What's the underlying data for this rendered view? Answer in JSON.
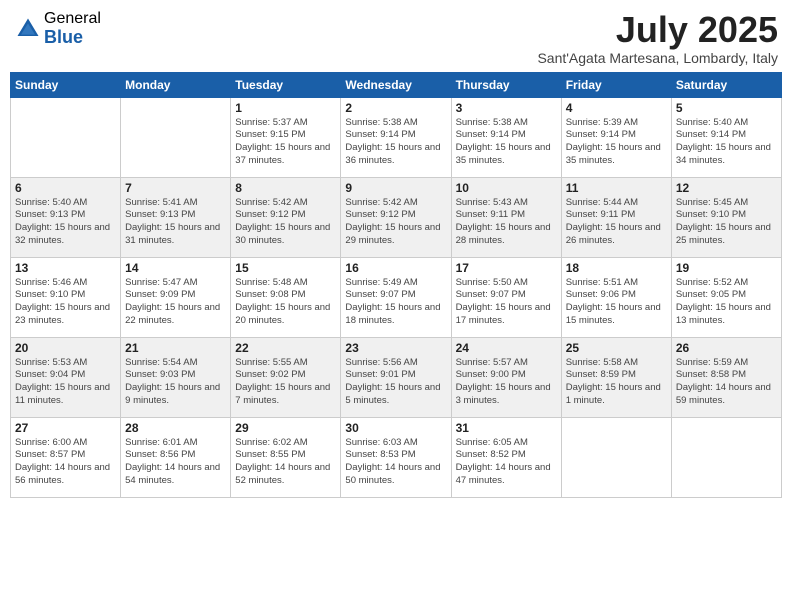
{
  "header": {
    "logo_general": "General",
    "logo_blue": "Blue",
    "month_title": "July 2025",
    "subtitle": "Sant'Agata Martesana, Lombardy, Italy"
  },
  "weekdays": [
    "Sunday",
    "Monday",
    "Tuesday",
    "Wednesday",
    "Thursday",
    "Friday",
    "Saturday"
  ],
  "weeks": [
    [
      {
        "day": "",
        "sunrise": "",
        "sunset": "",
        "daylight": ""
      },
      {
        "day": "",
        "sunrise": "",
        "sunset": "",
        "daylight": ""
      },
      {
        "day": "1",
        "sunrise": "Sunrise: 5:37 AM",
        "sunset": "Sunset: 9:15 PM",
        "daylight": "Daylight: 15 hours and 37 minutes."
      },
      {
        "day": "2",
        "sunrise": "Sunrise: 5:38 AM",
        "sunset": "Sunset: 9:14 PM",
        "daylight": "Daylight: 15 hours and 36 minutes."
      },
      {
        "day": "3",
        "sunrise": "Sunrise: 5:38 AM",
        "sunset": "Sunset: 9:14 PM",
        "daylight": "Daylight: 15 hours and 35 minutes."
      },
      {
        "day": "4",
        "sunrise": "Sunrise: 5:39 AM",
        "sunset": "Sunset: 9:14 PM",
        "daylight": "Daylight: 15 hours and 35 minutes."
      },
      {
        "day": "5",
        "sunrise": "Sunrise: 5:40 AM",
        "sunset": "Sunset: 9:14 PM",
        "daylight": "Daylight: 15 hours and 34 minutes."
      }
    ],
    [
      {
        "day": "6",
        "sunrise": "Sunrise: 5:40 AM",
        "sunset": "Sunset: 9:13 PM",
        "daylight": "Daylight: 15 hours and 32 minutes."
      },
      {
        "day": "7",
        "sunrise": "Sunrise: 5:41 AM",
        "sunset": "Sunset: 9:13 PM",
        "daylight": "Daylight: 15 hours and 31 minutes."
      },
      {
        "day": "8",
        "sunrise": "Sunrise: 5:42 AM",
        "sunset": "Sunset: 9:12 PM",
        "daylight": "Daylight: 15 hours and 30 minutes."
      },
      {
        "day": "9",
        "sunrise": "Sunrise: 5:42 AM",
        "sunset": "Sunset: 9:12 PM",
        "daylight": "Daylight: 15 hours and 29 minutes."
      },
      {
        "day": "10",
        "sunrise": "Sunrise: 5:43 AM",
        "sunset": "Sunset: 9:11 PM",
        "daylight": "Daylight: 15 hours and 28 minutes."
      },
      {
        "day": "11",
        "sunrise": "Sunrise: 5:44 AM",
        "sunset": "Sunset: 9:11 PM",
        "daylight": "Daylight: 15 hours and 26 minutes."
      },
      {
        "day": "12",
        "sunrise": "Sunrise: 5:45 AM",
        "sunset": "Sunset: 9:10 PM",
        "daylight": "Daylight: 15 hours and 25 minutes."
      }
    ],
    [
      {
        "day": "13",
        "sunrise": "Sunrise: 5:46 AM",
        "sunset": "Sunset: 9:10 PM",
        "daylight": "Daylight: 15 hours and 23 minutes."
      },
      {
        "day": "14",
        "sunrise": "Sunrise: 5:47 AM",
        "sunset": "Sunset: 9:09 PM",
        "daylight": "Daylight: 15 hours and 22 minutes."
      },
      {
        "day": "15",
        "sunrise": "Sunrise: 5:48 AM",
        "sunset": "Sunset: 9:08 PM",
        "daylight": "Daylight: 15 hours and 20 minutes."
      },
      {
        "day": "16",
        "sunrise": "Sunrise: 5:49 AM",
        "sunset": "Sunset: 9:07 PM",
        "daylight": "Daylight: 15 hours and 18 minutes."
      },
      {
        "day": "17",
        "sunrise": "Sunrise: 5:50 AM",
        "sunset": "Sunset: 9:07 PM",
        "daylight": "Daylight: 15 hours and 17 minutes."
      },
      {
        "day": "18",
        "sunrise": "Sunrise: 5:51 AM",
        "sunset": "Sunset: 9:06 PM",
        "daylight": "Daylight: 15 hours and 15 minutes."
      },
      {
        "day": "19",
        "sunrise": "Sunrise: 5:52 AM",
        "sunset": "Sunset: 9:05 PM",
        "daylight": "Daylight: 15 hours and 13 minutes."
      }
    ],
    [
      {
        "day": "20",
        "sunrise": "Sunrise: 5:53 AM",
        "sunset": "Sunset: 9:04 PM",
        "daylight": "Daylight: 15 hours and 11 minutes."
      },
      {
        "day": "21",
        "sunrise": "Sunrise: 5:54 AM",
        "sunset": "Sunset: 9:03 PM",
        "daylight": "Daylight: 15 hours and 9 minutes."
      },
      {
        "day": "22",
        "sunrise": "Sunrise: 5:55 AM",
        "sunset": "Sunset: 9:02 PM",
        "daylight": "Daylight: 15 hours and 7 minutes."
      },
      {
        "day": "23",
        "sunrise": "Sunrise: 5:56 AM",
        "sunset": "Sunset: 9:01 PM",
        "daylight": "Daylight: 15 hours and 5 minutes."
      },
      {
        "day": "24",
        "sunrise": "Sunrise: 5:57 AM",
        "sunset": "Sunset: 9:00 PM",
        "daylight": "Daylight: 15 hours and 3 minutes."
      },
      {
        "day": "25",
        "sunrise": "Sunrise: 5:58 AM",
        "sunset": "Sunset: 8:59 PM",
        "daylight": "Daylight: 15 hours and 1 minute."
      },
      {
        "day": "26",
        "sunrise": "Sunrise: 5:59 AM",
        "sunset": "Sunset: 8:58 PM",
        "daylight": "Daylight: 14 hours and 59 minutes."
      }
    ],
    [
      {
        "day": "27",
        "sunrise": "Sunrise: 6:00 AM",
        "sunset": "Sunset: 8:57 PM",
        "daylight": "Daylight: 14 hours and 56 minutes."
      },
      {
        "day": "28",
        "sunrise": "Sunrise: 6:01 AM",
        "sunset": "Sunset: 8:56 PM",
        "daylight": "Daylight: 14 hours and 54 minutes."
      },
      {
        "day": "29",
        "sunrise": "Sunrise: 6:02 AM",
        "sunset": "Sunset: 8:55 PM",
        "daylight": "Daylight: 14 hours and 52 minutes."
      },
      {
        "day": "30",
        "sunrise": "Sunrise: 6:03 AM",
        "sunset": "Sunset: 8:53 PM",
        "daylight": "Daylight: 14 hours and 50 minutes."
      },
      {
        "day": "31",
        "sunrise": "Sunrise: 6:05 AM",
        "sunset": "Sunset: 8:52 PM",
        "daylight": "Daylight: 14 hours and 47 minutes."
      },
      {
        "day": "",
        "sunrise": "",
        "sunset": "",
        "daylight": ""
      },
      {
        "day": "",
        "sunrise": "",
        "sunset": "",
        "daylight": ""
      }
    ]
  ]
}
